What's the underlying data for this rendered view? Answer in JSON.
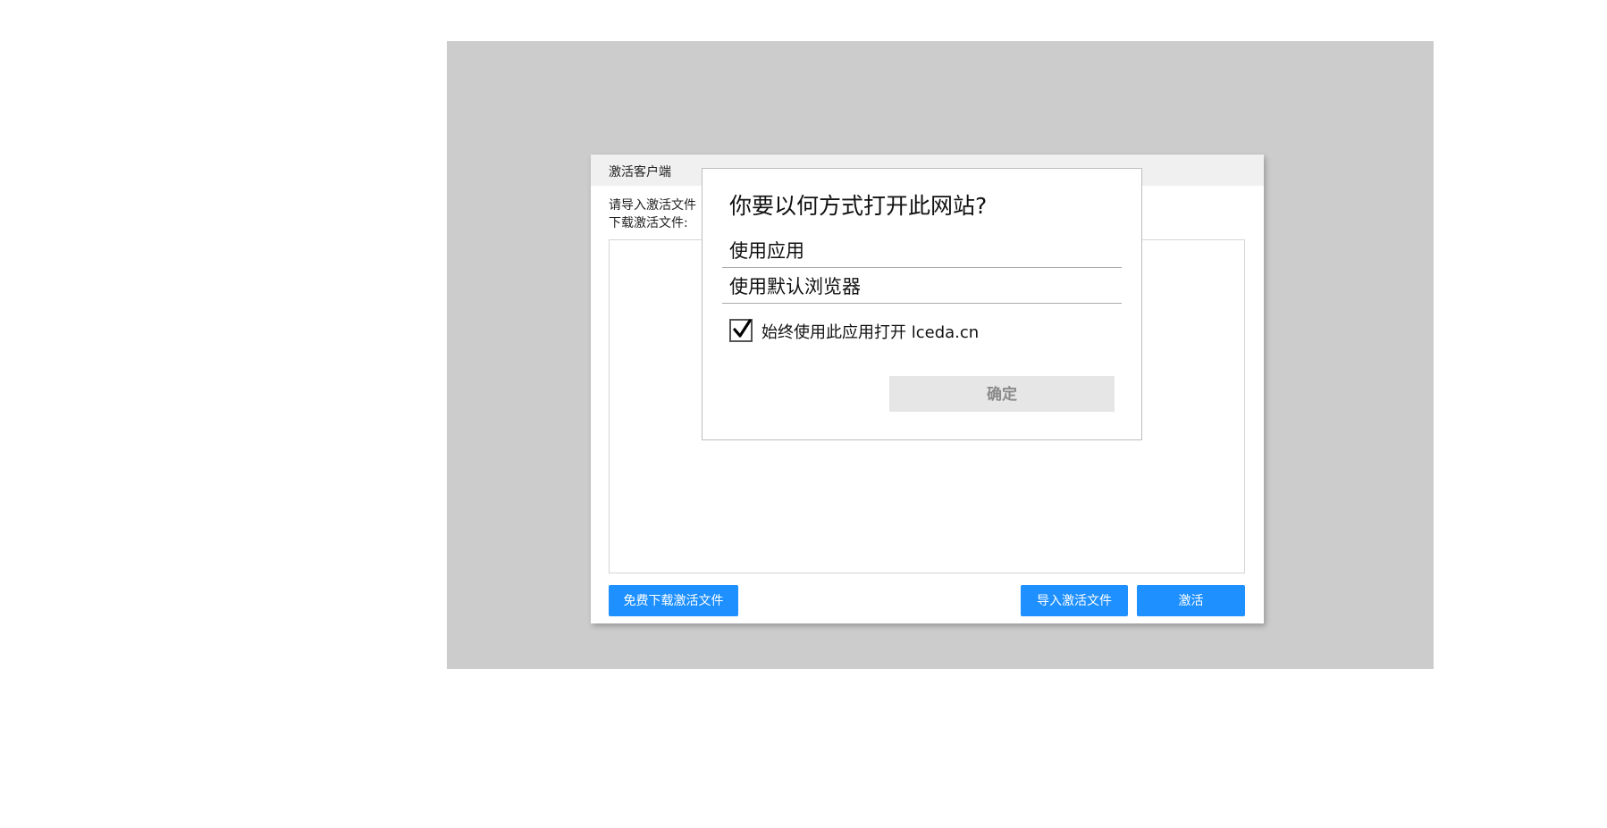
{
  "client_window": {
    "title": "激活客户端",
    "line1": "请导入激活文件",
    "line2": "下载激活文件:",
    "download_button": "免费下载激活文件",
    "import_button": "导入激活文件",
    "activate_button": "激活"
  },
  "open_with_dialog": {
    "title": "你要以何方式打开此网站?",
    "options": [
      {
        "label": "使用应用"
      },
      {
        "label": "使用默认浏览器"
      }
    ],
    "always_use_label": "始终使用此应用打开 lceda.cn",
    "always_use_checked": true,
    "ok_button": "确定"
  },
  "colors": {
    "accent_blue": "#1e90ff",
    "backdrop_gray": "#cccccc"
  }
}
